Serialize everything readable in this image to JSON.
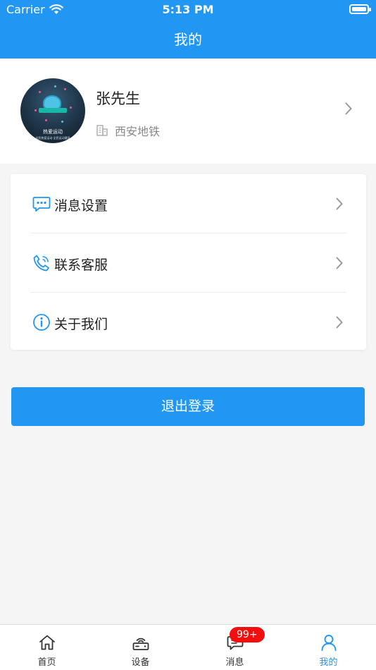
{
  "status_bar": {
    "carrier": "Carrier",
    "time": "5:13 PM"
  },
  "header": {
    "title": "我的"
  },
  "profile": {
    "name": "张先生",
    "organization": "西安地铁",
    "avatar_text_1": "热爱运动",
    "avatar_text_2": "全民热爱运动 全民运动健身",
    "avatar_badge": "100day"
  },
  "menu": {
    "items": [
      {
        "label": "消息设置",
        "icon": "message-settings-icon"
      },
      {
        "label": "联系客服",
        "icon": "phone-icon"
      },
      {
        "label": "关于我们",
        "icon": "info-icon"
      }
    ]
  },
  "logout": {
    "label": "退出登录"
  },
  "tabbar": {
    "items": [
      {
        "label": "首页",
        "icon": "home-icon"
      },
      {
        "label": "设备",
        "icon": "router-icon"
      },
      {
        "label": "消息",
        "icon": "chat-icon",
        "badge": "99+"
      },
      {
        "label": "我的",
        "icon": "user-icon",
        "active": true
      }
    ]
  },
  "colors": {
    "primary": "#2196f3",
    "badge": "#f20f0f",
    "background": "#f5f5f5"
  }
}
